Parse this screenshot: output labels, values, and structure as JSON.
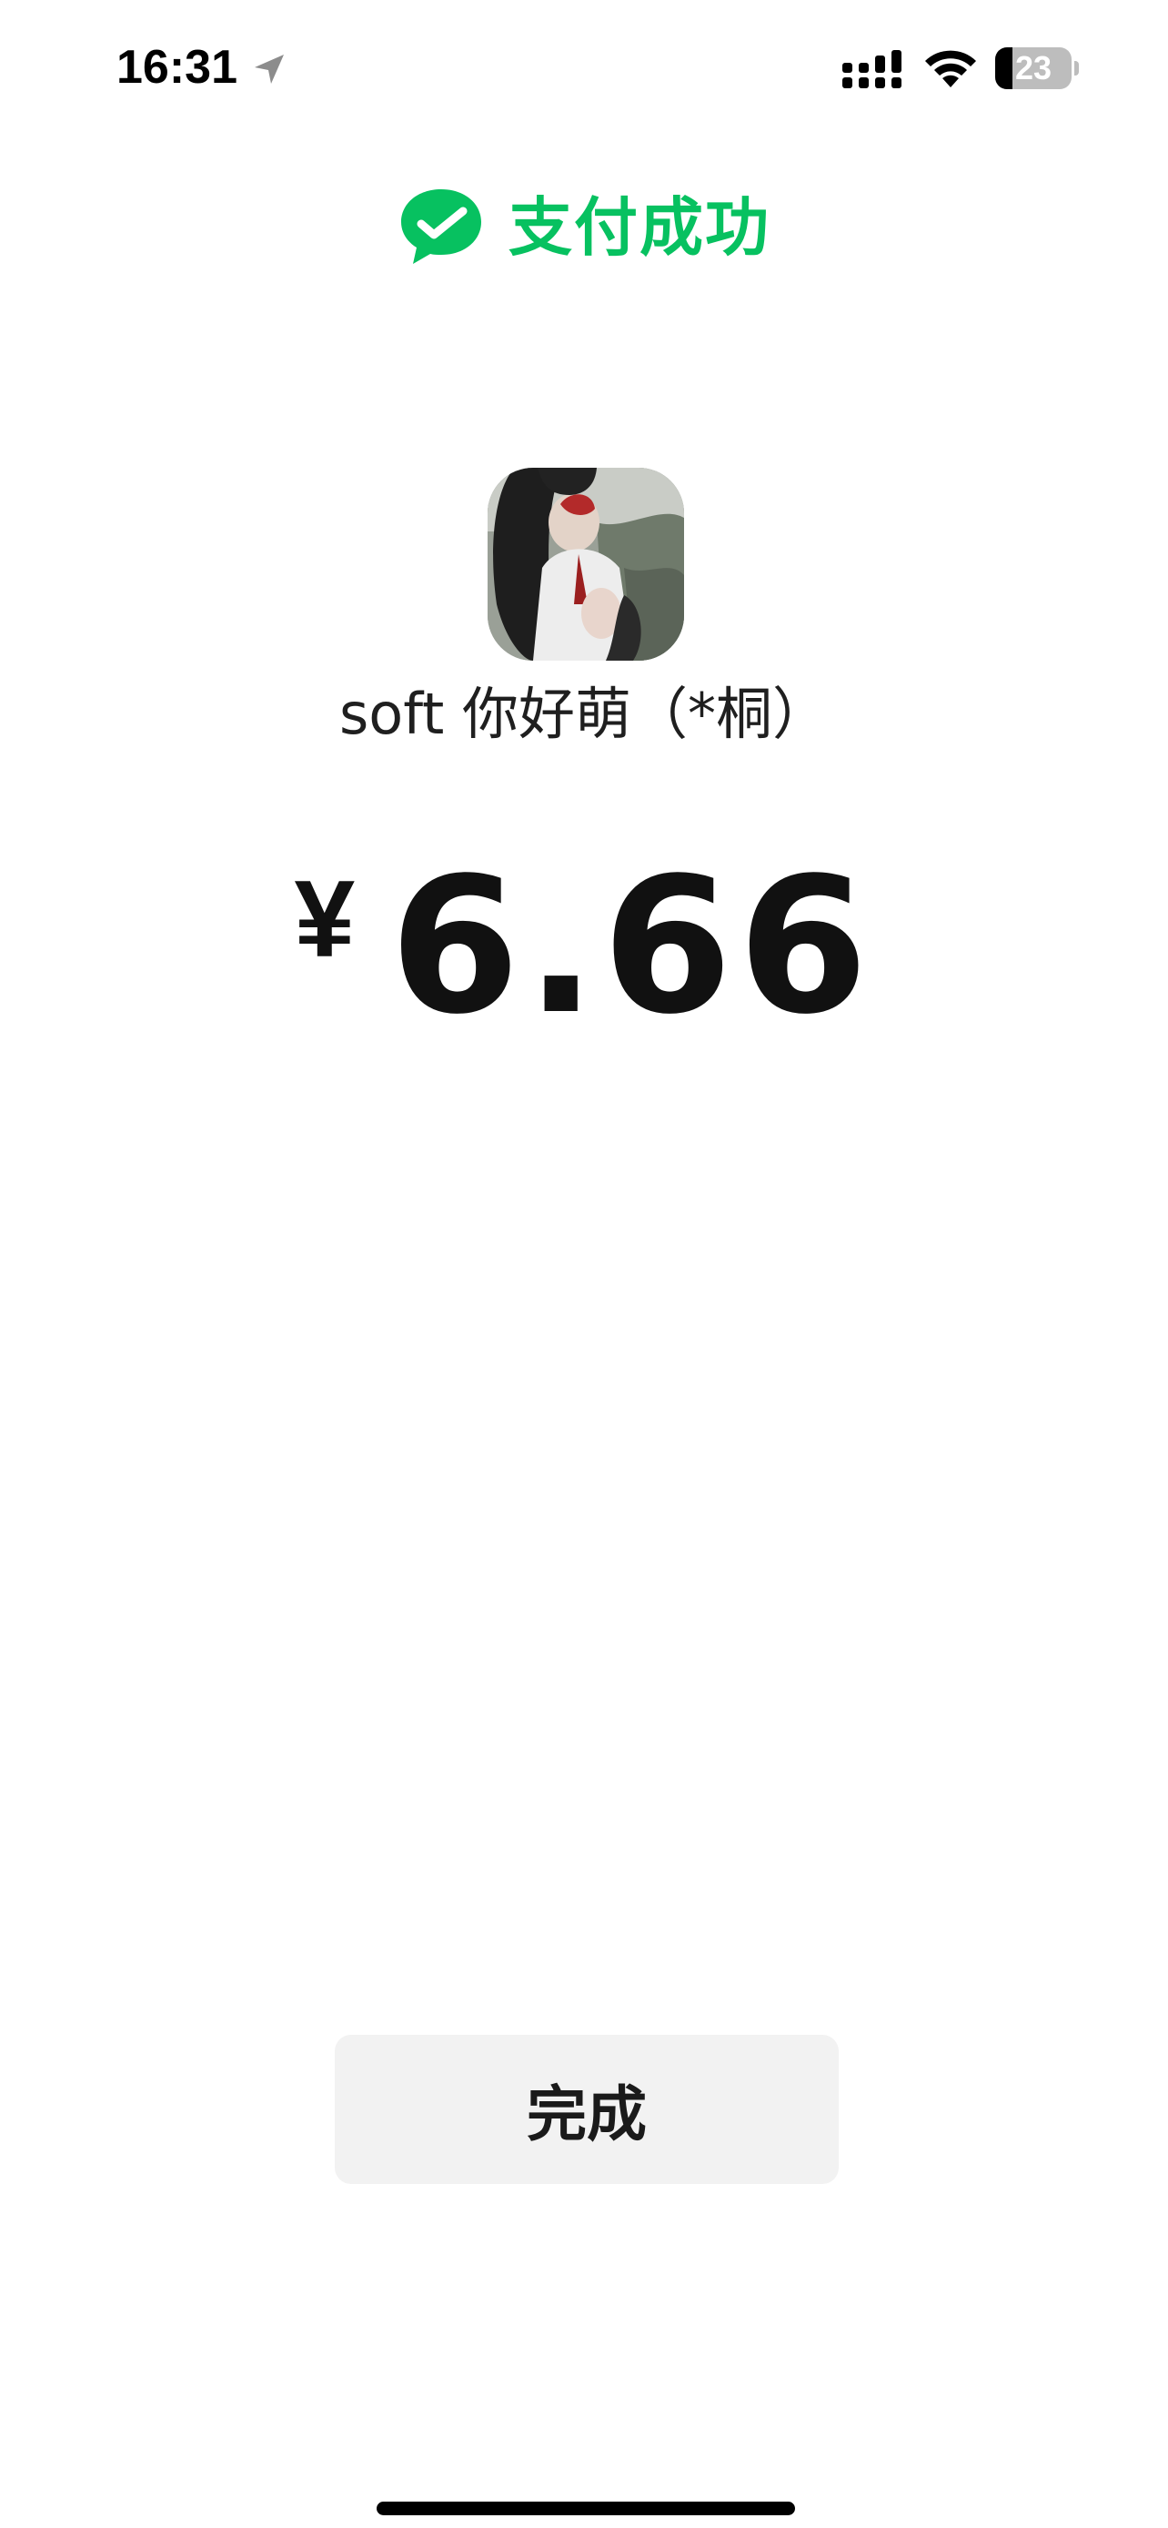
{
  "status_bar": {
    "time": "16:31",
    "battery_level": "23",
    "battery_fraction": 0.23,
    "icons": [
      "location-arrow-icon",
      "cellular-signal-icon",
      "wifi-icon",
      "battery-icon"
    ]
  },
  "header": {
    "icon": "wechat-pay-check-icon",
    "title": "支付成功"
  },
  "payee": {
    "avatar": "payee-photo",
    "name": "soft 你好萌（*桐）"
  },
  "payment": {
    "currency": "¥",
    "amount": "6.66"
  },
  "actions": {
    "done_label": "完成"
  },
  "colors": {
    "accent": "#07c160",
    "text": "#1a1a1a",
    "button_bg": "#f2f2f2",
    "background": "#ffffff"
  }
}
